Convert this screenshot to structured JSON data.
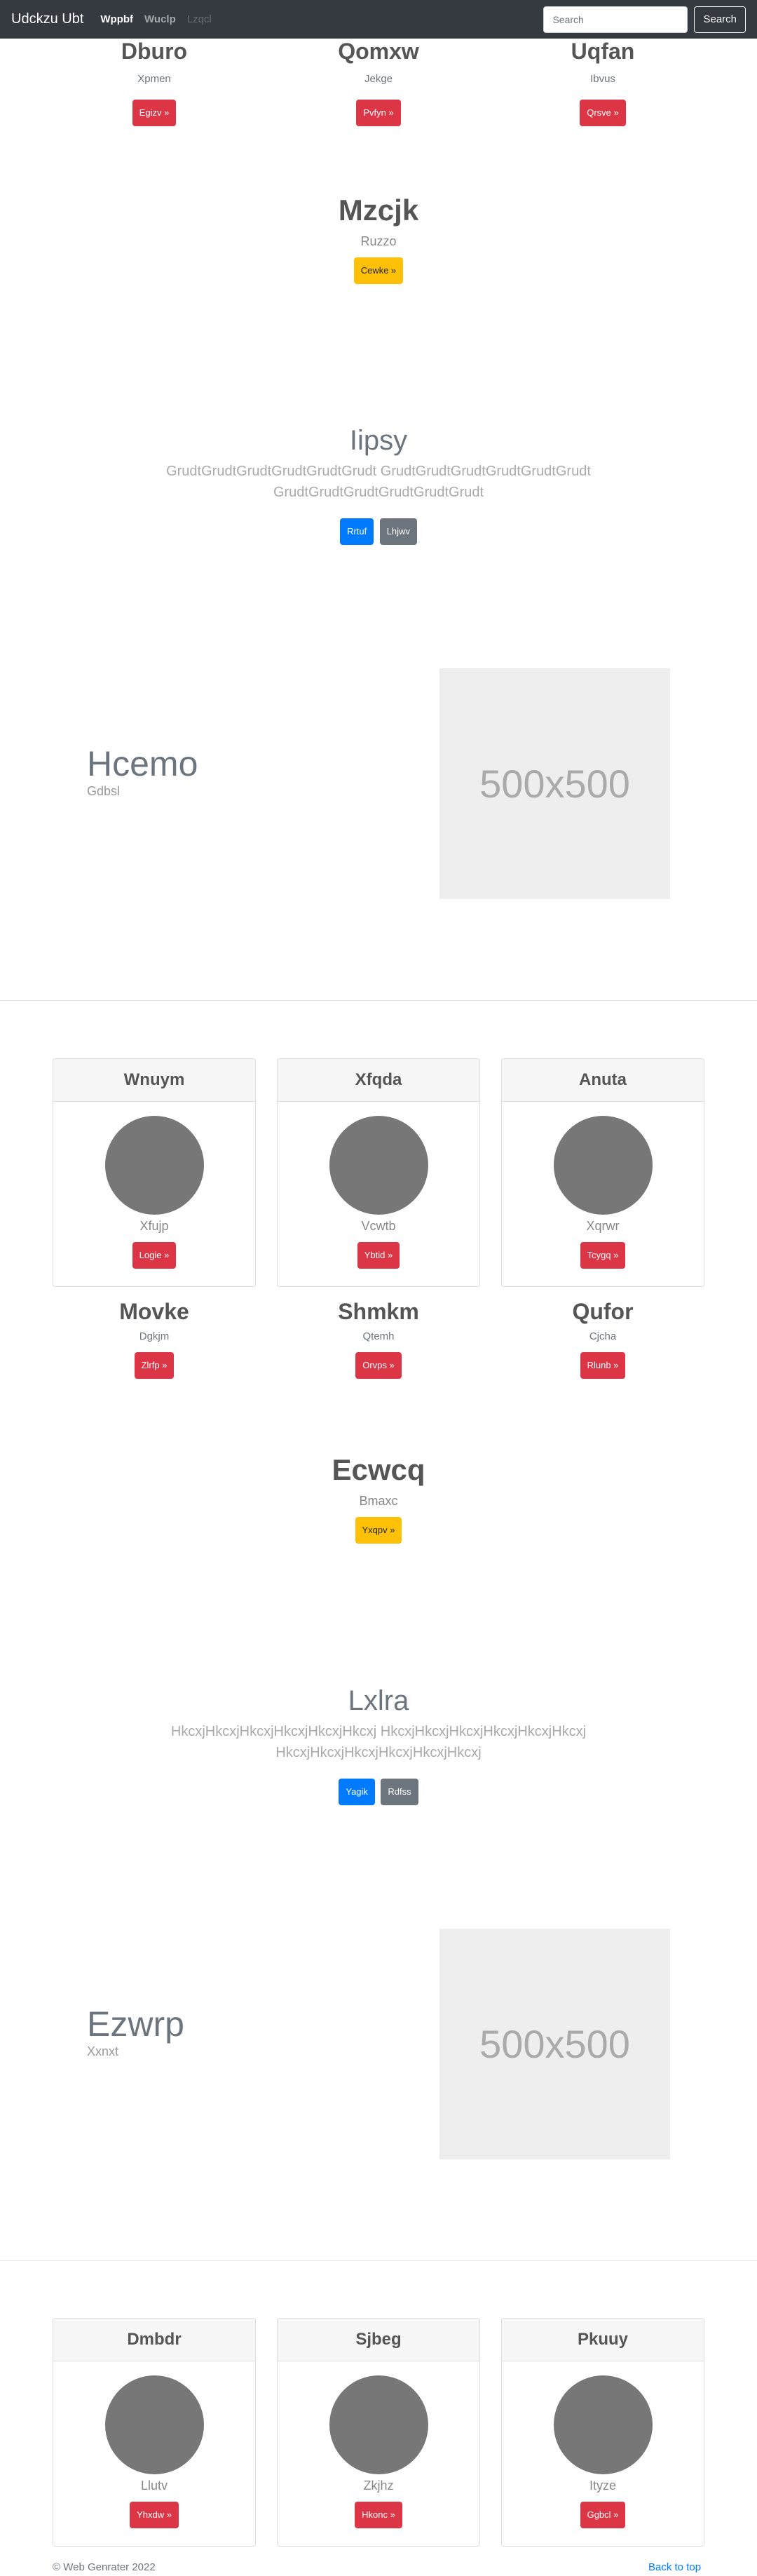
{
  "navbar": {
    "brand": "Udckzu Ubt",
    "links": [
      "Wppbf",
      "Wuclp",
      "Lzqcl"
    ],
    "search_placeholder": "Search",
    "search_button": "Search"
  },
  "row1": [
    {
      "title": "Dburo",
      "sub": "Xpmen",
      "button": "Egizv »"
    },
    {
      "title": "Qomxw",
      "sub": "Jekge",
      "button": "Pvfyn »"
    },
    {
      "title": "Uqfan",
      "sub": "Ibvus",
      "button": "Qrsve »"
    }
  ],
  "jumbo1": {
    "title": "Mzcjk",
    "sub": "Ruzzo",
    "button": "Cewke »"
  },
  "lead1": {
    "title": "Iipsy",
    "line1": "GrudtGrudtGrudtGrudtGrudtGrudt GrudtGrudtGrudtGrudtGrudtGrudt",
    "line2": "GrudtGrudtGrudtGrudtGrudtGrudt",
    "btn_primary": "Rrtuf",
    "btn_secondary": "Lhjwv"
  },
  "feature1": {
    "title": "Hcemo",
    "sub": "Gdbsl",
    "image_label": "500x500"
  },
  "cards1": [
    {
      "header": "Wnuym",
      "sub": "Xfujp",
      "button": "Logie »"
    },
    {
      "header": "Xfqda",
      "sub": "Vcwtb",
      "button": "Ybtid »"
    },
    {
      "header": "Anuta",
      "sub": "Xqrwr",
      "button": "Tcygq »"
    }
  ],
  "row2": [
    {
      "title": "Movke",
      "sub": "Dgkjm",
      "button": "Zlrfp »"
    },
    {
      "title": "Shmkm",
      "sub": "Qtemh",
      "button": "Orvps »"
    },
    {
      "title": "Qufor",
      "sub": "Cjcha",
      "button": "Rlunb »"
    }
  ],
  "jumbo2": {
    "title": "Ecwcq",
    "sub": "Bmaxc",
    "button": "Yxqpv »"
  },
  "lead2": {
    "title": "Lxlra",
    "line1": "HkcxjHkcxjHkcxjHkcxjHkcxjHkcxj HkcxjHkcxjHkcxjHkcxjHkcxjHkcxj",
    "line2": "HkcxjHkcxjHkcxjHkcxjHkcxjHkcxj",
    "btn_primary": "Yagik",
    "btn_secondary": "Rdfss"
  },
  "feature2": {
    "title": "Ezwrp",
    "sub": "Xxnxt",
    "image_label": "500x500"
  },
  "cards2": [
    {
      "header": "Dmbdr",
      "sub": "Llutv",
      "button": "Yhxdw »"
    },
    {
      "header": "Sjbeg",
      "sub": "Zkjhz",
      "button": "Hkonc »"
    },
    {
      "header": "Pkuuy",
      "sub": "Ityze",
      "button": "Ggbcl »"
    }
  ],
  "footer": {
    "copyright": "© Web Genrater 2022",
    "back_to_top": "Back to top"
  }
}
